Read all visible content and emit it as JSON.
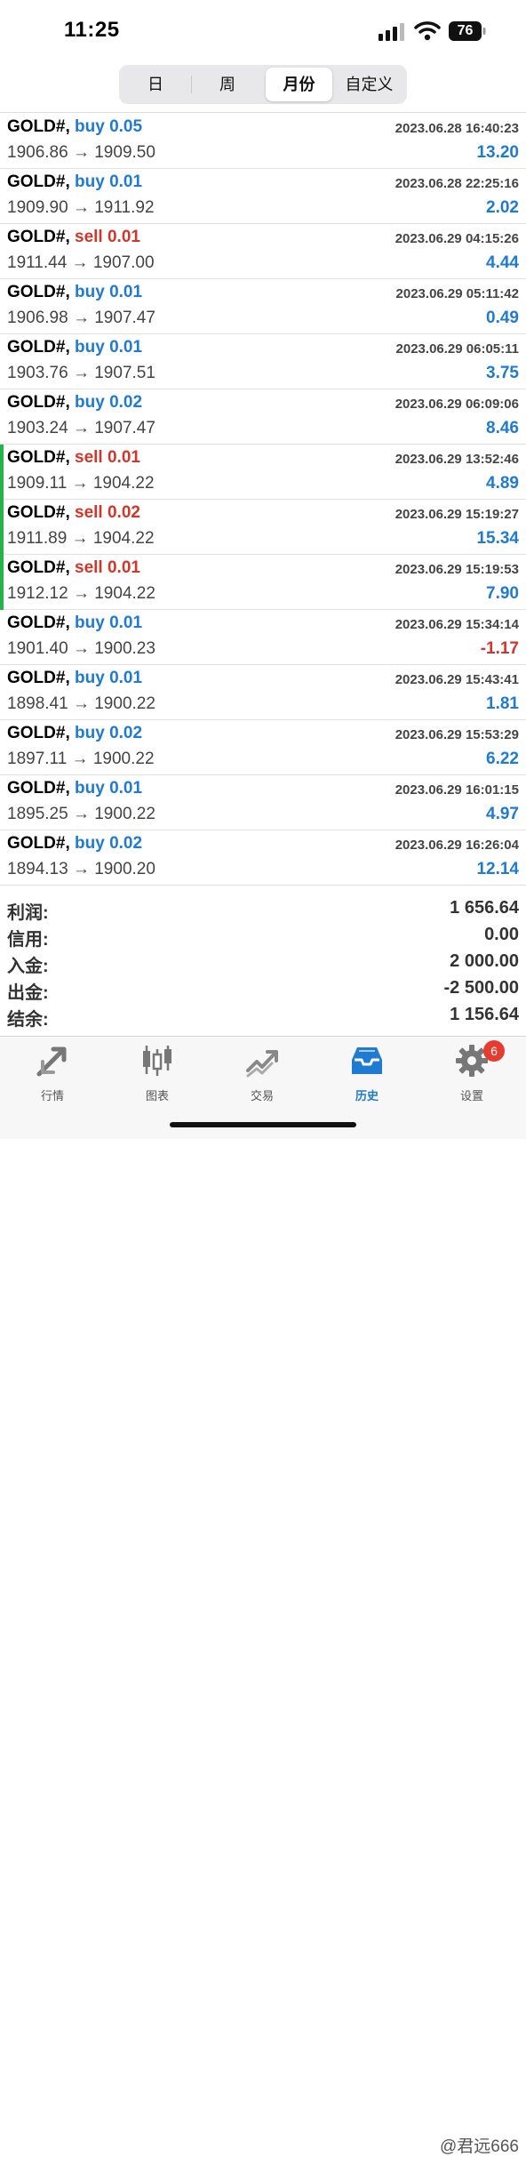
{
  "status_bar": {
    "time": "11:25",
    "battery": "76"
  },
  "segments": [
    {
      "label": "日",
      "active": false
    },
    {
      "label": "周",
      "active": false
    },
    {
      "label": "月份",
      "active": true
    },
    {
      "label": "自定义",
      "active": false
    }
  ],
  "trades": [
    {
      "symbol": "GOLD#,",
      "action": "buy 0.05",
      "side": "buy",
      "time": "2023.06.28 16:40:23",
      "prices": "1906.86 → 1909.50",
      "profit": "13.20",
      "marked": false
    },
    {
      "symbol": "GOLD#,",
      "action": "buy 0.01",
      "side": "buy",
      "time": "2023.06.28 22:25:16",
      "prices": "1909.90 → 1911.92",
      "profit": "2.02",
      "marked": false
    },
    {
      "symbol": "GOLD#,",
      "action": "sell 0.01",
      "side": "sell",
      "time": "2023.06.29 04:15:26",
      "prices": "1911.44 → 1907.00",
      "profit": "4.44",
      "marked": false
    },
    {
      "symbol": "GOLD#,",
      "action": "buy 0.01",
      "side": "buy",
      "time": "2023.06.29 05:11:42",
      "prices": "1906.98 → 1907.47",
      "profit": "0.49",
      "marked": false
    },
    {
      "symbol": "GOLD#,",
      "action": "buy 0.01",
      "side": "buy",
      "time": "2023.06.29 06:05:11",
      "prices": "1903.76 → 1907.51",
      "profit": "3.75",
      "marked": false
    },
    {
      "symbol": "GOLD#,",
      "action": "buy 0.02",
      "side": "buy",
      "time": "2023.06.29 06:09:06",
      "prices": "1903.24 → 1907.47",
      "profit": "8.46",
      "marked": false
    },
    {
      "symbol": "GOLD#,",
      "action": "sell 0.01",
      "side": "sell",
      "time": "2023.06.29 13:52:46",
      "prices": "1909.11 → 1904.22",
      "profit": "4.89",
      "marked": true
    },
    {
      "symbol": "GOLD#,",
      "action": "sell 0.02",
      "side": "sell",
      "time": "2023.06.29 15:19:27",
      "prices": "1911.89 → 1904.22",
      "profit": "15.34",
      "marked": true
    },
    {
      "symbol": "GOLD#,",
      "action": "sell 0.01",
      "side": "sell",
      "time": "2023.06.29 15:19:53",
      "prices": "1912.12 → 1904.22",
      "profit": "7.90",
      "marked": true
    },
    {
      "symbol": "GOLD#,",
      "action": "buy 0.01",
      "side": "buy",
      "time": "2023.06.29 15:34:14",
      "prices": "1901.40 → 1900.23",
      "profit": "-1.17",
      "marked": false
    },
    {
      "symbol": "GOLD#,",
      "action": "buy 0.01",
      "side": "buy",
      "time": "2023.06.29 15:43:41",
      "prices": "1898.41 → 1900.22",
      "profit": "1.81",
      "marked": false
    },
    {
      "symbol": "GOLD#,",
      "action": "buy 0.02",
      "side": "buy",
      "time": "2023.06.29 15:53:29",
      "prices": "1897.11 → 1900.22",
      "profit": "6.22",
      "marked": false
    },
    {
      "symbol": "GOLD#,",
      "action": "buy 0.01",
      "side": "buy",
      "time": "2023.06.29 16:01:15",
      "prices": "1895.25 → 1900.22",
      "profit": "4.97",
      "marked": false
    },
    {
      "symbol": "GOLD#,",
      "action": "buy 0.02",
      "side": "buy",
      "time": "2023.06.29 16:26:04",
      "prices": "1894.13 → 1900.20",
      "profit": "12.14",
      "marked": false
    }
  ],
  "summary": [
    {
      "label": "利润:",
      "value": "1 656.64"
    },
    {
      "label": "信用:",
      "value": "0.00"
    },
    {
      "label": "入金:",
      "value": "2 000.00"
    },
    {
      "label": "出金:",
      "value": "-2 500.00"
    },
    {
      "label": "结余:",
      "value": "1 156.64"
    }
  ],
  "tabs": [
    {
      "label": "行情",
      "icon": "quotes-arrows-icon",
      "active": false
    },
    {
      "label": "图表",
      "icon": "candlestick-chart-icon",
      "active": false
    },
    {
      "label": "交易",
      "icon": "trade-chart-icon",
      "active": false
    },
    {
      "label": "历史",
      "icon": "history-inbox-icon",
      "active": true
    },
    {
      "label": "设置",
      "icon": "gear-icon",
      "active": false,
      "badge": "6"
    }
  ],
  "watermark": "@君远666",
  "colors": {
    "buy": "#1f7bd1",
    "sell": "#d0362a",
    "accent_marker": "#27b34a",
    "badge": "#e53b30"
  }
}
